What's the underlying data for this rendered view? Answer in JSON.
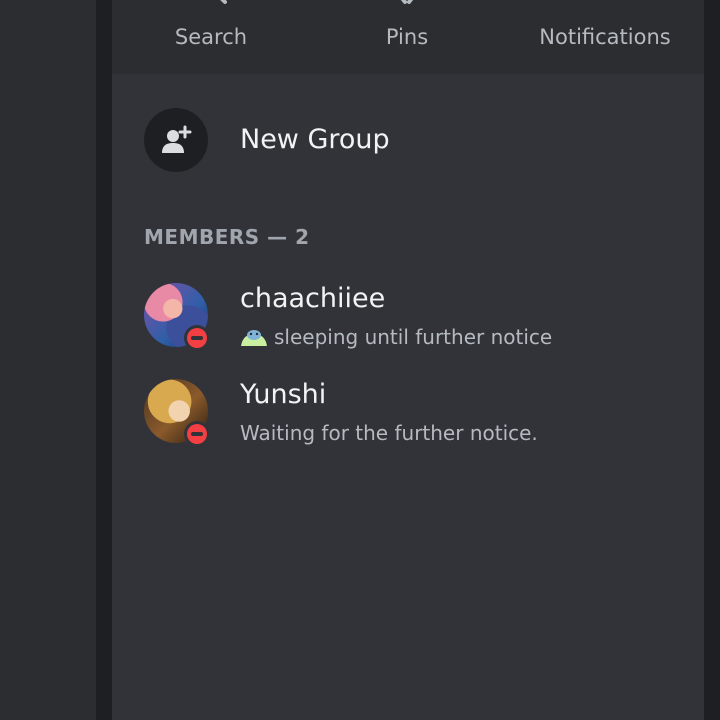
{
  "toolbar": {
    "search_label": "Search",
    "pins_label": "Pins",
    "notifications_label": "Notifications"
  },
  "new_group": {
    "label": "New Group",
    "icon": "add-person-icon"
  },
  "members": {
    "header": "MEMBERS — 2",
    "items": [
      {
        "name": "chaachiiee",
        "status_text": "sleeping until further notice",
        "status": "do-not-disturb",
        "custom_emoji": "sleeping-emoji"
      },
      {
        "name": "Yunshi",
        "status_text": "Waiting for the further notice.",
        "status": "do-not-disturb"
      }
    ]
  },
  "colors": {
    "background": "#1e1f22",
    "panel": "#313338",
    "action_bar": "#2b2d31",
    "text_primary": "#f2f3f5",
    "text_muted": "#b5bac1",
    "dnd_red": "#f23f43"
  }
}
